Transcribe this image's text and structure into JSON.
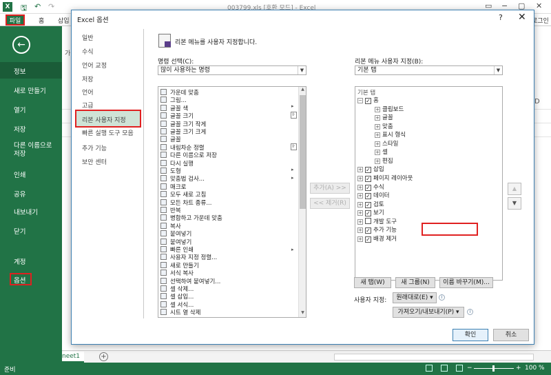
{
  "excel": {
    "window_title": "003799.xls [호환 모드] - Excel",
    "logo_letter": "X",
    "ribbon_tabs": [
      "파일",
      "홈",
      "삽입"
    ],
    "right_header": "로그인",
    "col_letter_d": "D",
    "ribbon_letter": "가"
  },
  "backstage": {
    "back_glyph": "←",
    "items": [
      "정보",
      "새로 만들기",
      "열기",
      "저장",
      "다른 이름으로 저장",
      "인쇄",
      "공유",
      "내보내기",
      "닫기",
      "계정",
      "옵션"
    ]
  },
  "status": {
    "left": "준비",
    "zoom": "100 %",
    "sheet_tab": "neet1",
    "minus": "−",
    "plus": "+"
  },
  "dialog": {
    "title": "Excel 옵션",
    "help": "?",
    "close": "✕",
    "nav": [
      "일반",
      "수식",
      "언어 교정",
      "저장",
      "언어",
      "고급",
      "리본 사용자 지정",
      "빠른 실행 도구 모음",
      "추가 기능",
      "보안 센터"
    ],
    "header_text": "리본 메뉴를 사용자 지정합니다.",
    "commands_label": "명령 선택(C):",
    "commands_combo": "많이 사용하는 명령",
    "ribbon_label": "리본 메뉴 사용자 지정(B):",
    "ribbon_combo": "기본 탭",
    "commands": [
      "가운데 맞춤",
      "그림...",
      "글꼴 색",
      "글꼴 크기",
      "글꼴 크기 작게",
      "글꼴 크기 크게",
      "글꼴",
      "내림차순 정렬",
      "다른 이름으로 저장",
      "다시 실행",
      "도형",
      "맞춤법 검사...",
      "매크로",
      "모두 새로 고침",
      "모든 차트 종류...",
      "반복",
      "병합하고 가운데 맞춤",
      "복사",
      "붙여넣기",
      "붙여넣기",
      "빠른 인쇄",
      "사용자 지정 정렬...",
      "새로 만들기",
      "서식 복사",
      "선택하여 붙여넣기...",
      "셀 삭제...",
      "셀 삽입...",
      "셀 서식...",
      "시트 열 삭제"
    ],
    "add_button": "추가(A) >>",
    "remove_button": "<< 제거(R)",
    "tree_header": "기본 탭",
    "tree": [
      {
        "label": "홈",
        "expanded": true,
        "checked": true,
        "level": 0
      },
      {
        "label": "클립보드",
        "level": 1
      },
      {
        "label": "글꼴",
        "level": 1
      },
      {
        "label": "맞춤",
        "level": 1
      },
      {
        "label": "표시 형식",
        "level": 1
      },
      {
        "label": "스타일",
        "level": 1
      },
      {
        "label": "셀",
        "level": 1
      },
      {
        "label": "편집",
        "level": 1
      },
      {
        "label": "삽입",
        "checked": true,
        "level": 0
      },
      {
        "label": "페이지 레이아웃",
        "checked": true,
        "level": 0
      },
      {
        "label": "수식",
        "checked": true,
        "level": 0
      },
      {
        "label": "데이터",
        "checked": true,
        "level": 0
      },
      {
        "label": "검토",
        "checked": true,
        "level": 0
      },
      {
        "label": "보기",
        "checked": true,
        "level": 0
      },
      {
        "label": "개발 도구",
        "checked": false,
        "level": 0
      },
      {
        "label": "추가 기능",
        "checked": true,
        "level": 0
      },
      {
        "label": "배경 제거",
        "checked": true,
        "level": 0
      }
    ],
    "new_tab_button": "새 탭(W)",
    "new_group_button": "새 그룹(N)",
    "rename_button": "이름 바꾸기(M)...",
    "customize_label": "사용자 지정:",
    "reset_combo": "원래대로(E) ▾",
    "import_export_combo": "가져오기/내보내기(P) ▾",
    "ok_button": "확인",
    "cancel_button": "취소",
    "up_arrow": "▲",
    "down_arrow": "▼"
  }
}
